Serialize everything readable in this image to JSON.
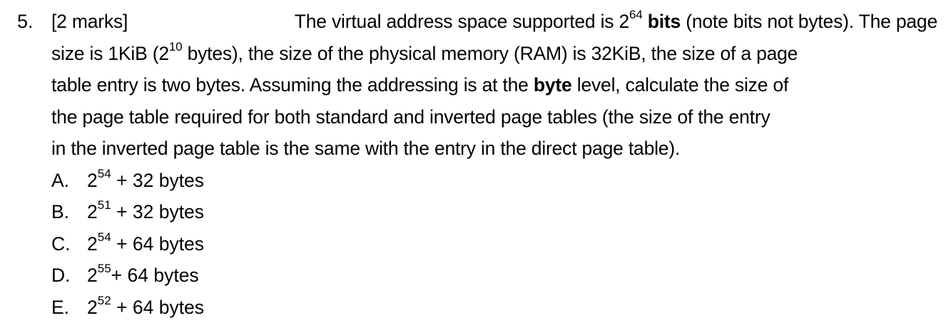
{
  "question": {
    "number": "5.",
    "marks": "[2 marks]",
    "line1": {
      "a": "The virtual address space supported is 2",
      "a_exp": "64",
      "bold": "bits",
      "b": "(note bits not bytes). The page"
    },
    "line2": {
      "a": "size is 1KiB (2",
      "a_exp": "10",
      "b": " bytes), the size of the physical memory (RAM) is 32KiB, the size of a page"
    },
    "line3": {
      "a": "table entry is two bytes. Assuming the addressing is at the ",
      "bold": "byte",
      "b": " level, calculate the size of"
    },
    "line4": "the page table required for both standard and inverted page tables (the size of the entry",
    "line5": "in the inverted page table is the same with the entry in the direct page table)."
  },
  "options": [
    {
      "letter": "A.",
      "base": "2",
      "exp": "54",
      "rest": " + 32 bytes"
    },
    {
      "letter": "B.",
      "base": "2",
      "exp": "51",
      "rest": " + 32 bytes"
    },
    {
      "letter": "C.",
      "base": "2",
      "exp": "54",
      "rest": " + 64 bytes"
    },
    {
      "letter": "D.",
      "base": "2",
      "exp": "55",
      "rest": "+ 64 bytes"
    },
    {
      "letter": "E.",
      "base": "2",
      "exp": "52",
      "rest": " + 64 bytes"
    }
  ]
}
